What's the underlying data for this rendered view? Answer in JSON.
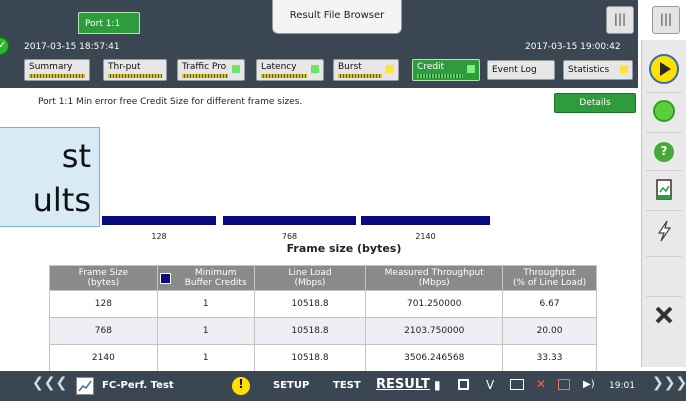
{
  "header": {
    "port_tab": "Port 1:1",
    "window_title": "Result File Browser",
    "timestamp_left": "2017-03-15 18:57:41",
    "timestamp_right": "2017-03-15 19:00:42",
    "tabs": [
      {
        "label": "Summary"
      },
      {
        "label": "Thr-put"
      },
      {
        "label": "Traffic Pro"
      },
      {
        "label": "Latency"
      },
      {
        "label": "Burst"
      },
      {
        "label": "Credit"
      }
    ],
    "event_log_label": "Event Log",
    "statistics_label": "Statistics"
  },
  "content": {
    "subtitle": "Port 1:1 Min error free Credit Size for different frame sizes.",
    "details_label": "Details"
  },
  "callout": {
    "line1": "st",
    "line2": "ults"
  },
  "chart_data": {
    "type": "bar",
    "categories": [
      "128",
      "768",
      "2140"
    ],
    "values": [
      1,
      1,
      1
    ],
    "xlabel": "Frame size (bytes)",
    "bar_color": "#0a0a7e"
  },
  "table": {
    "headers": [
      [
        "Frame Size",
        "(bytes)"
      ],
      [
        "Minimum",
        "Buffer Credits"
      ],
      [
        "Line Load",
        "(Mbps)"
      ],
      [
        "Measured Throughput",
        "(Mbps)"
      ],
      [
        "Throughput",
        "(% of Line Load)"
      ]
    ],
    "rows": [
      [
        "128",
        "1",
        "10518.8",
        "701.250000",
        "6.67"
      ],
      [
        "768",
        "1",
        "10518.8",
        "2103.750000",
        "20.00"
      ],
      [
        "2140",
        "1",
        "10518.8",
        "3506.246568",
        "33.33"
      ]
    ]
  },
  "bottom": {
    "app_name": "FC-Perf. Test",
    "setup": "SETUP",
    "test": "TEST",
    "result": "RESULT",
    "clock": "19:01"
  },
  "colors": {
    "header_bg": "#3a4652",
    "accent_green": "#2e9c3c",
    "bar": "#0a0a7e"
  }
}
